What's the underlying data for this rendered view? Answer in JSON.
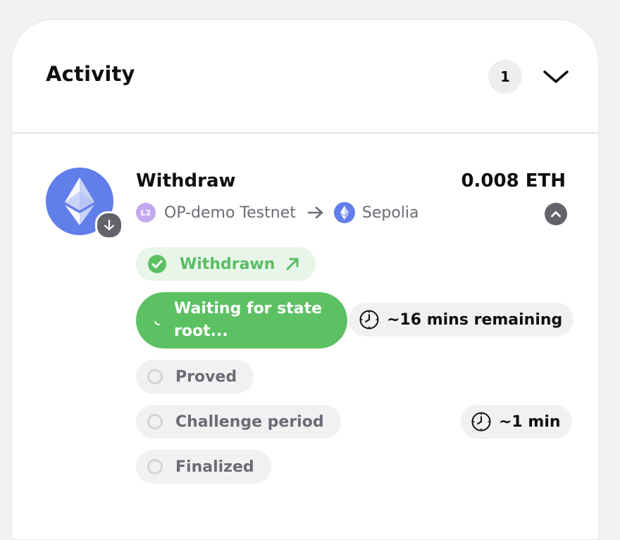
{
  "activity": {
    "title": "Activity",
    "count": "1"
  },
  "transaction": {
    "type": "Withdraw",
    "amount": "0.008 ETH",
    "from_network": "OP-demo Testnet",
    "from_badge": "L2",
    "to_network": "Sepolia"
  },
  "steps": [
    {
      "label": "Withdrawn",
      "status": "done"
    },
    {
      "label_line1": "Waiting for state",
      "label_line2": "root...",
      "status": "active",
      "time": "~16 mins remaining"
    },
    {
      "label": "Proved",
      "status": "pending"
    },
    {
      "label": "Challenge period",
      "status": "pending",
      "time": "~1 min"
    },
    {
      "label": "Finalized",
      "status": "pending"
    }
  ],
  "colors": {
    "success": "#5cc163",
    "eth": "#627eea",
    "l2": "#c5a9ee",
    "muted": "#6b6c75"
  }
}
